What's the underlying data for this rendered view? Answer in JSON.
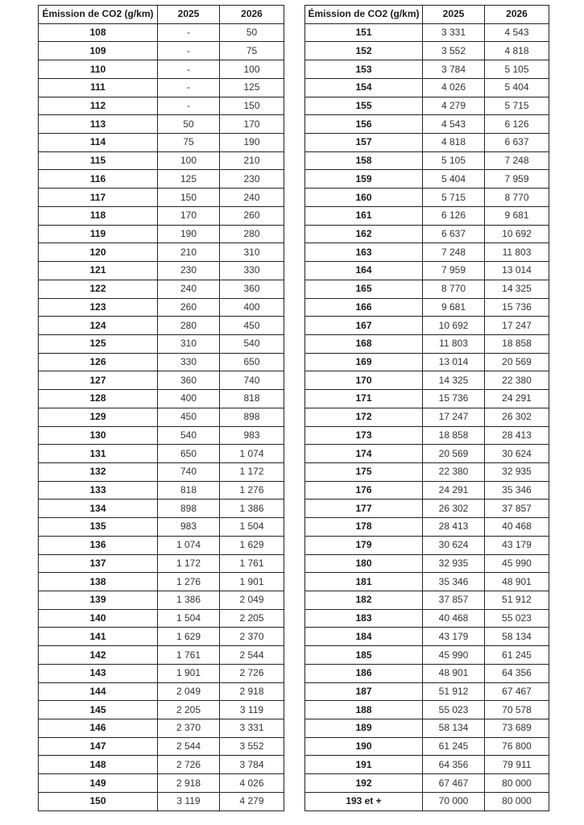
{
  "headers": {
    "emission": "Émission de CO2 (g/km)",
    "y2025": "2025",
    "y2026": "2026"
  },
  "left_rows": [
    [
      "108",
      "-",
      "50"
    ],
    [
      "109",
      "-",
      "75"
    ],
    [
      "110",
      "-",
      "100"
    ],
    [
      "111",
      "-",
      "125"
    ],
    [
      "112",
      "-",
      "150"
    ],
    [
      "113",
      "50",
      "170"
    ],
    [
      "114",
      "75",
      "190"
    ],
    [
      "115",
      "100",
      "210"
    ],
    [
      "116",
      "125",
      "230"
    ],
    [
      "117",
      "150",
      "240"
    ],
    [
      "118",
      "170",
      "260"
    ],
    [
      "119",
      "190",
      "280"
    ],
    [
      "120",
      "210",
      "310"
    ],
    [
      "121",
      "230",
      "330"
    ],
    [
      "122",
      "240",
      "360"
    ],
    [
      "123",
      "260",
      "400"
    ],
    [
      "124",
      "280",
      "450"
    ],
    [
      "125",
      "310",
      "540"
    ],
    [
      "126",
      "330",
      "650"
    ],
    [
      "127",
      "360",
      "740"
    ],
    [
      "128",
      "400",
      "818"
    ],
    [
      "129",
      "450",
      "898"
    ],
    [
      "130",
      "540",
      "983"
    ],
    [
      "131",
      "650",
      "1 074"
    ],
    [
      "132",
      "740",
      "1 172"
    ],
    [
      "133",
      "818",
      "1 276"
    ],
    [
      "134",
      "898",
      "1 386"
    ],
    [
      "135",
      "983",
      "1 504"
    ],
    [
      "136",
      "1 074",
      "1 629"
    ],
    [
      "137",
      "1 172",
      "1 761"
    ],
    [
      "138",
      "1 276",
      "1 901"
    ],
    [
      "139",
      "1 386",
      "2 049"
    ],
    [
      "140",
      "1 504",
      "2 205"
    ],
    [
      "141",
      "1 629",
      "2 370"
    ],
    [
      "142",
      "1 761",
      "2 544"
    ],
    [
      "143",
      "1 901",
      "2 726"
    ],
    [
      "144",
      "2 049",
      "2 918"
    ],
    [
      "145",
      "2 205",
      "3 119"
    ],
    [
      "146",
      "2 370",
      "3 331"
    ],
    [
      "147",
      "2 544",
      "3 552"
    ],
    [
      "148",
      "2 726",
      "3 784"
    ],
    [
      "149",
      "2 918",
      "4 026"
    ],
    [
      "150",
      "3 119",
      "4 279"
    ]
  ],
  "right_rows": [
    [
      "151",
      "3 331",
      "4 543"
    ],
    [
      "152",
      "3 552",
      "4 818"
    ],
    [
      "153",
      "3 784",
      "5 105"
    ],
    [
      "154",
      "4 026",
      "5 404"
    ],
    [
      "155",
      "4 279",
      "5 715"
    ],
    [
      "156",
      "4 543",
      "6 126"
    ],
    [
      "157",
      "4 818",
      "6 637"
    ],
    [
      "158",
      "5 105",
      "7 248"
    ],
    [
      "159",
      "5 404",
      "7 959"
    ],
    [
      "160",
      "5 715",
      "8 770"
    ],
    [
      "161",
      "6 126",
      "9 681"
    ],
    [
      "162",
      "6 637",
      "10 692"
    ],
    [
      "163",
      "7 248",
      "11 803"
    ],
    [
      "164",
      "7 959",
      "13 014"
    ],
    [
      "165",
      "8 770",
      "14 325"
    ],
    [
      "166",
      "9 681",
      "15 736"
    ],
    [
      "167",
      "10 692",
      "17 247"
    ],
    [
      "168",
      "11 803",
      "18 858"
    ],
    [
      "169",
      "13 014",
      "20 569"
    ],
    [
      "170",
      "14 325",
      "22 380"
    ],
    [
      "171",
      "15 736",
      "24 291"
    ],
    [
      "172",
      "17 247",
      "26 302"
    ],
    [
      "173",
      "18 858",
      "28 413"
    ],
    [
      "174",
      "20 569",
      "30 624"
    ],
    [
      "175",
      "22 380",
      "32 935"
    ],
    [
      "176",
      "24 291",
      "35 346"
    ],
    [
      "177",
      "26 302",
      "37 857"
    ],
    [
      "178",
      "28 413",
      "40 468"
    ],
    [
      "179",
      "30 624",
      "43 179"
    ],
    [
      "180",
      "32 935",
      "45 990"
    ],
    [
      "181",
      "35 346",
      "48 901"
    ],
    [
      "182",
      "37 857",
      "51 912"
    ],
    [
      "183",
      "40 468",
      "55 023"
    ],
    [
      "184",
      "43 179",
      "58 134"
    ],
    [
      "185",
      "45 990",
      "61 245"
    ],
    [
      "186",
      "48 901",
      "64 356"
    ],
    [
      "187",
      "51 912",
      "67 467"
    ],
    [
      "188",
      "55 023",
      "70 578"
    ],
    [
      "189",
      "58 134",
      "73 689"
    ],
    [
      "190",
      "61 245",
      "76 800"
    ],
    [
      "191",
      "64 356",
      "79 911"
    ],
    [
      "192",
      "67 467",
      "80 000"
    ],
    [
      "193 et +",
      "70 000",
      "80 000"
    ]
  ]
}
